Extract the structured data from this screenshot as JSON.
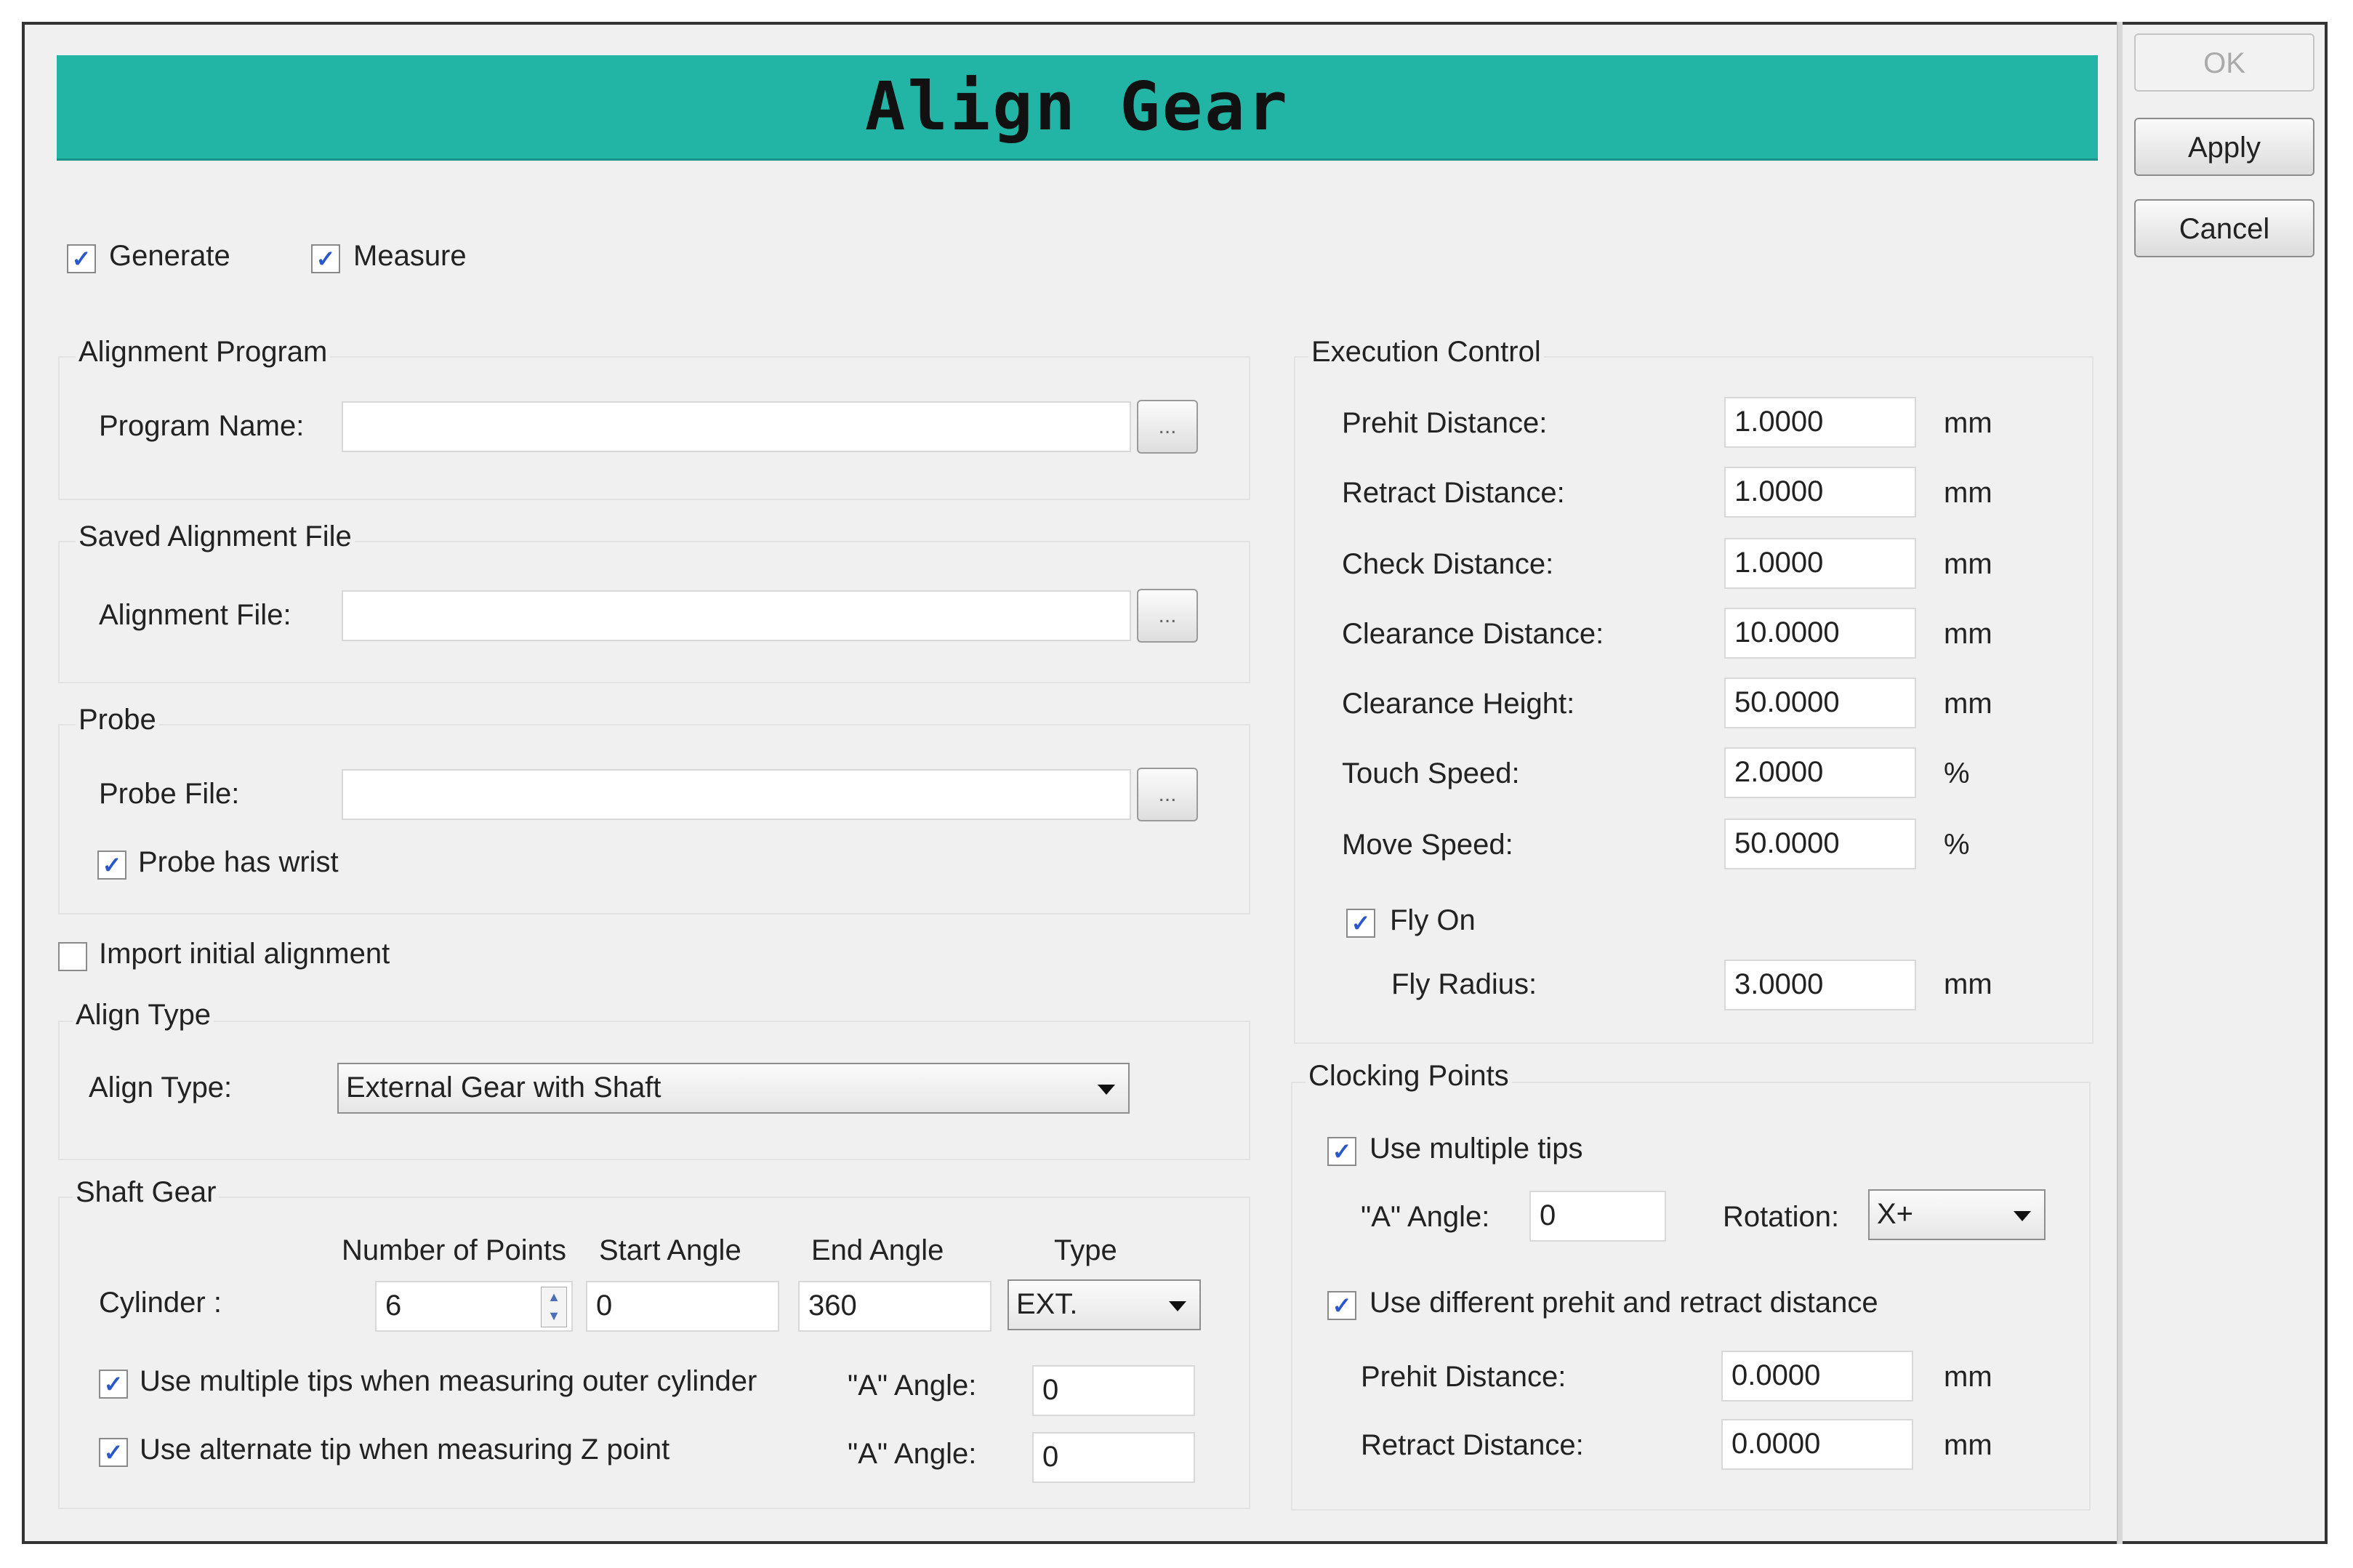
{
  "title": "Align Gear",
  "buttons": {
    "ok": "OK",
    "apply": "Apply",
    "cancel": "Cancel"
  },
  "top_checks": {
    "generate": "Generate",
    "measure": "Measure",
    "mark": "✓"
  },
  "alignment_program": {
    "group": "Alignment Program",
    "label": "Program Name:",
    "value": "",
    "browse": "..."
  },
  "saved_alignment": {
    "group": "Saved Alignment File",
    "label": "Alignment File:",
    "value": "",
    "browse": "..."
  },
  "probe": {
    "group": "Probe",
    "label": "Probe File:",
    "value": "",
    "browse": "...",
    "wrist_label": "Probe has wrist"
  },
  "import_label": "Import initial alignment",
  "align_type": {
    "group": "Align Type",
    "label": "Align Type:",
    "value": "External Gear with Shaft"
  },
  "shaft_gear": {
    "group": "Shaft Gear",
    "headers": {
      "points": "Number of Points",
      "start": "Start Angle",
      "end": "End Angle",
      "type": "Type"
    },
    "row_label": "Cylinder :",
    "points": "6",
    "start": "0",
    "end": "360",
    "type": "EXT.",
    "multi_tips_label": "Use multiple tips when measuring outer cylinder",
    "alt_tip_label": "Use alternate tip when measuring Z point",
    "a_angle_label": "\"A\" Angle:",
    "a_angle_1": "0",
    "a_angle_2": "0"
  },
  "execution": {
    "group": "Execution Control",
    "rows": [
      {
        "label": "Prehit Distance:",
        "value": "1.0000",
        "unit": "mm"
      },
      {
        "label": "Retract Distance:",
        "value": "1.0000",
        "unit": "mm"
      },
      {
        "label": "Check Distance:",
        "value": "1.0000",
        "unit": "mm"
      },
      {
        "label": "Clearance Distance:",
        "value": "10.0000",
        "unit": "mm"
      },
      {
        "label": "Clearance Height:",
        "value": "50.0000",
        "unit": "mm"
      },
      {
        "label": "Touch Speed:",
        "value": "2.0000",
        "unit": "%"
      },
      {
        "label": "Move Speed:",
        "value": "50.0000",
        "unit": "%"
      }
    ],
    "fly_on": "Fly On",
    "fly_radius": {
      "label": "Fly Radius:",
      "value": "3.0000",
      "unit": "mm"
    }
  },
  "clocking": {
    "group": "Clocking Points",
    "multi_tips": "Use multiple tips",
    "a_angle_label": "\"A\" Angle:",
    "a_angle": "0",
    "rotation_label": "Rotation:",
    "rotation": "X+",
    "diff_label": "Use different prehit and retract distance",
    "prehit": {
      "label": "Prehit Distance:",
      "value": "0.0000",
      "unit": "mm"
    },
    "retract": {
      "label": "Retract Distance:",
      "value": "0.0000",
      "unit": "mm"
    }
  }
}
